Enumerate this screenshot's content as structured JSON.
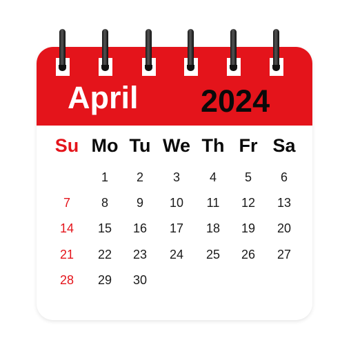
{
  "calendar": {
    "month": "April",
    "year": "2024",
    "weekdays": [
      "Su",
      "Mo",
      "Tu",
      "We",
      "Th",
      "Fr",
      "Sa"
    ],
    "weeks": [
      [
        "",
        "1",
        "2",
        "3",
        "4",
        "5",
        "6"
      ],
      [
        "7",
        "8",
        "9",
        "10",
        "11",
        "12",
        "13"
      ],
      [
        "14",
        "15",
        "16",
        "17",
        "18",
        "19",
        "20"
      ],
      [
        "21",
        "22",
        "23",
        "24",
        "25",
        "26",
        "27"
      ],
      [
        "28",
        "29",
        "30",
        "",
        "",
        "",
        ""
      ]
    ],
    "binding_ring_count": 6
  },
  "colors": {
    "header": "#e4141b",
    "sunday": "#e4141b",
    "month_text": "#ffffff",
    "year_text": "#0a0a0a"
  },
  "icons": [
    "spiral-binding-ring-icon"
  ]
}
